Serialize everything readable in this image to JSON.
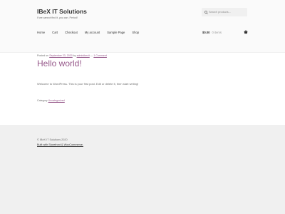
{
  "site": {
    "title": "IBeX IT Solutions",
    "tagline": "If we cannot find it, you can. Period!"
  },
  "search": {
    "placeholder": "Search products…",
    "icon": "search-icon"
  },
  "nav": {
    "items": [
      "Home",
      "Cart",
      "Checkout",
      "My account",
      "Sample Page",
      "Shop"
    ]
  },
  "cart": {
    "amount": "$0.00",
    "count": "0 items",
    "icon": "basket-icon"
  },
  "post": {
    "meta_prefix": "Posted on",
    "date": "September 23, 2020",
    "by": "by",
    "author": "adminibexit",
    "separator": "—",
    "comments": "1 Comment",
    "title": "Hello world!",
    "body": "Welcome to WordPress. This is your first post. Edit or delete it, then start writing!",
    "category_label": "Category",
    "category": "Uncategorized"
  },
  "footer": {
    "copyright": "© IBeX IT Solutions 2020",
    "credit": "Built with Storefront & WooCommerce."
  },
  "colors": {
    "accent": "#96588a",
    "header_bg": "#fafafa",
    "footer_bg": "#f0f0f0",
    "text": "#6d6d6d",
    "heading": "#333333"
  }
}
